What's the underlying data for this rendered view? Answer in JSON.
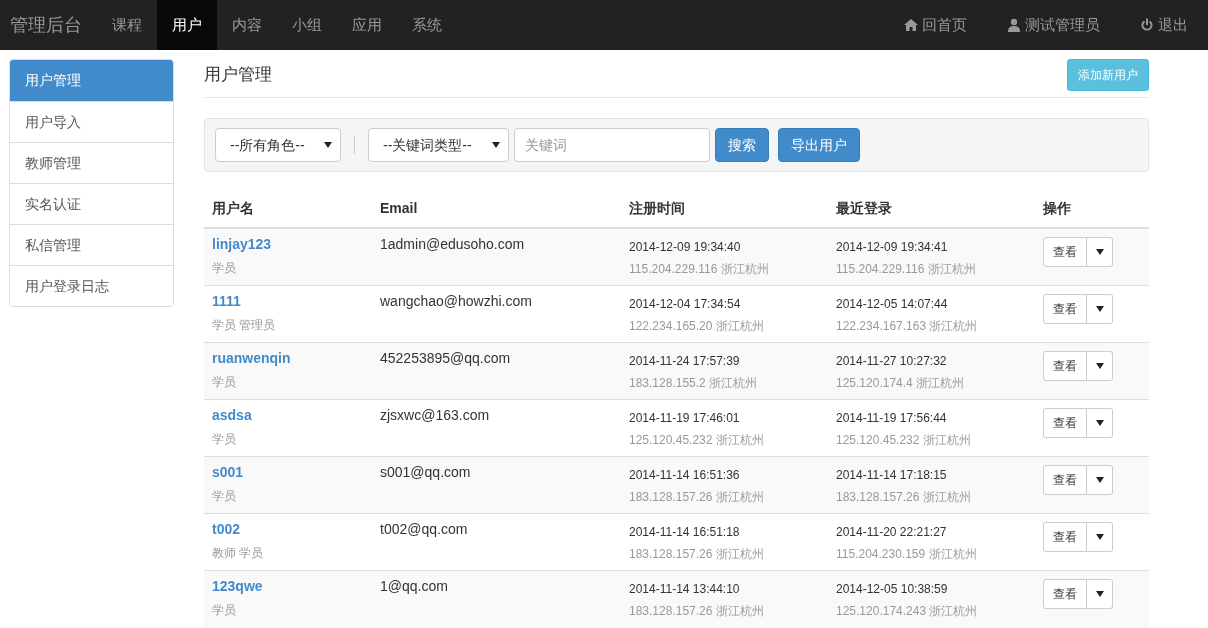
{
  "navbar": {
    "brand": "管理后台",
    "items": [
      {
        "label": "课程",
        "selected": false
      },
      {
        "label": "用户",
        "selected": true
      },
      {
        "label": "内容",
        "selected": false
      },
      {
        "label": "小组",
        "selected": false
      },
      {
        "label": "应用",
        "selected": false
      },
      {
        "label": "系统",
        "selected": false
      }
    ],
    "right_items": [
      {
        "kind": "home",
        "label": "回首页"
      },
      {
        "kind": "user",
        "label": "测试管理员"
      },
      {
        "kind": "power",
        "label": "退出"
      }
    ]
  },
  "sidebar": {
    "items": [
      {
        "label": "用户管理",
        "selected": true
      },
      {
        "label": "用户导入",
        "selected": false
      },
      {
        "label": "教师管理",
        "selected": false
      },
      {
        "label": "实名认证",
        "selected": false
      },
      {
        "label": "私信管理",
        "selected": false
      },
      {
        "label": "用户登录日志",
        "selected": false
      }
    ]
  },
  "page": {
    "title": "用户管理",
    "add_button": "添加新用户"
  },
  "filters": {
    "role_select": "--所有角色--",
    "keyword_type_select": "--关键词类型--",
    "keyword": {
      "placeholder": "关键词"
    },
    "search_button": "搜索",
    "export_button": "导出用户"
  },
  "table": {
    "columns": [
      "用户名",
      "Email",
      "注册时间",
      "最近登录",
      "操作"
    ],
    "rows": [
      {
        "username": "linjay123",
        "roles": "学员",
        "email": "1admin@edusoho.com",
        "registered": "2014-12-09 19:34:40",
        "registered_ip": "115.204.229.116 浙江杭州",
        "last_login": "2014-12-09 19:34:41",
        "last_login_ip": "115.204.229.116 浙江杭州",
        "action": "查看"
      },
      {
        "username": "1111",
        "roles": "学员 管理员",
        "email": "wangchao@howzhi.com",
        "registered": "2014-12-04 17:34:54",
        "registered_ip": "122.234.165.20 浙江杭州",
        "last_login": "2014-12-05 14:07:44",
        "last_login_ip": "122.234.167.163 浙江杭州",
        "action": "查看"
      },
      {
        "username": "ruanwenqin",
        "roles": "学员",
        "email": "452253895@qq.com",
        "registered": "2014-11-24 17:57:39",
        "registered_ip": "183.128.155.2 浙江杭州",
        "last_login": "2014-11-27 10:27:32",
        "last_login_ip": "125.120.174.4 浙江杭州",
        "action": "查看"
      },
      {
        "username": "asdsa",
        "roles": "学员",
        "email": "zjsxwc@163.com",
        "registered": "2014-11-19 17:46:01",
        "registered_ip": "125.120.45.232 浙江杭州",
        "last_login": "2014-11-19 17:56:44",
        "last_login_ip": "125.120.45.232 浙江杭州",
        "action": "查看"
      },
      {
        "username": "s001",
        "roles": "学员",
        "email": "s001@qq.com",
        "registered": "2014-11-14 16:51:36",
        "registered_ip": "183.128.157.26 浙江杭州",
        "last_login": "2014-11-14 17:18:15",
        "last_login_ip": "183.128.157.26 浙江杭州",
        "action": "查看"
      },
      {
        "username": "t002",
        "roles": "教师 学员",
        "email": "t002@qq.com",
        "registered": "2014-11-14 16:51:18",
        "registered_ip": "183.128.157.26 浙江杭州",
        "last_login": "2014-11-20 22:21:27",
        "last_login_ip": "115.204.230.159 浙江杭州",
        "action": "查看"
      },
      {
        "username": "123qwe",
        "roles": "学员",
        "email": "1@qq.com",
        "registered": "2014-11-14 13:44:10",
        "registered_ip": "183.128.157.26 浙江杭州",
        "last_login": "2014-12-05 10:38:59",
        "last_login_ip": "125.120.174.243 浙江杭州",
        "action": "查看"
      }
    ]
  }
}
